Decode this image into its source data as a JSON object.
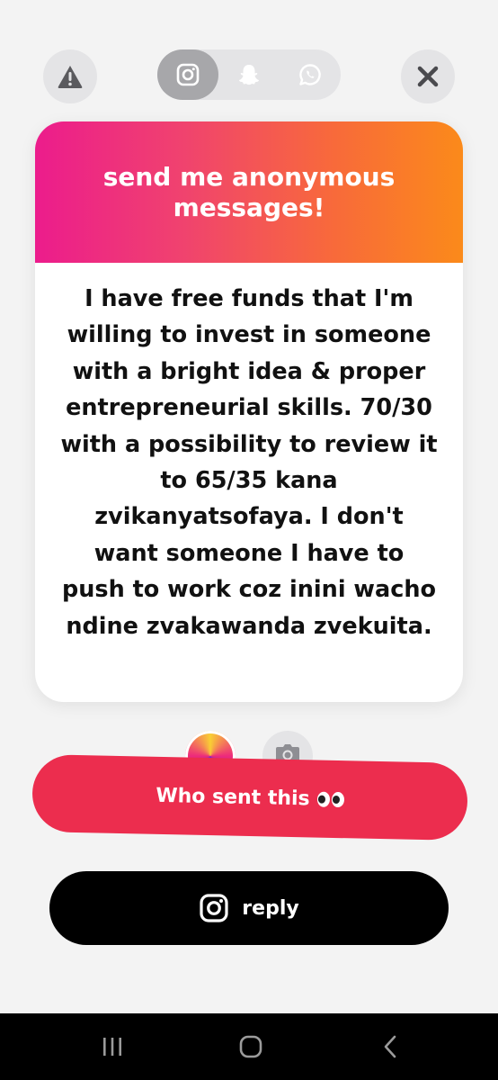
{
  "toolbar": {
    "icons": [
      "warning-icon",
      "close-icon"
    ],
    "platforms": [
      {
        "name": "instagram-icon",
        "active": true
      },
      {
        "name": "snapchat-icon",
        "active": false
      },
      {
        "name": "whatsapp-icon",
        "active": false
      }
    ]
  },
  "card": {
    "title": "send me anonymous messages!",
    "message": "I have free funds that I'm willing to invest in someone with a bright idea & proper entrepreneurial skills. 70/30 with a possibility to review it to 65/35 kana zvikanyatsofaya. I don't want someone I have to push to work coz inini wacho ndine zvakawanda zvekuita.",
    "header_gradient": [
      "#ec1c8c",
      "#fb8a1a"
    ]
  },
  "actions": {
    "who_sent_label": "Who sent this",
    "who_sent_emoji": "eyes-icon",
    "who_sent_color": "#ec2d4e",
    "reply_label": "reply",
    "reply_icon": "instagram-icon"
  },
  "system_nav": {
    "keys": [
      "recents-icon",
      "home-icon",
      "back-icon"
    ]
  }
}
